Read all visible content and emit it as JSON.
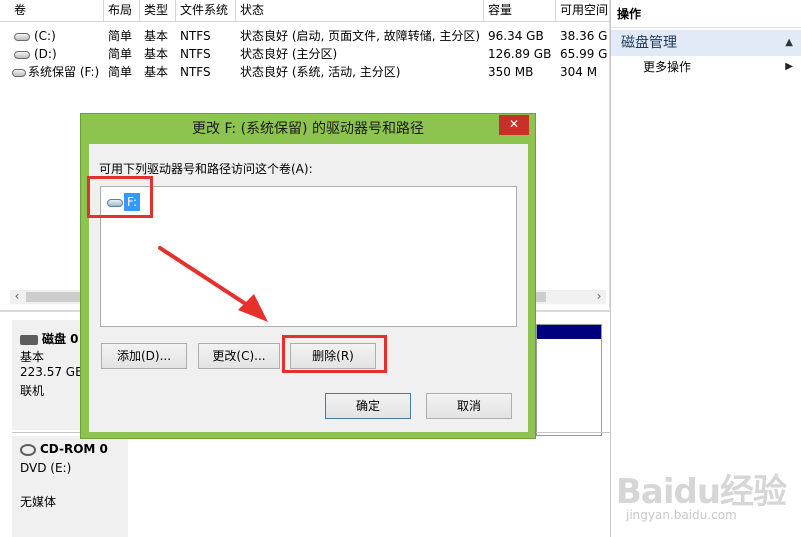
{
  "volume_table": {
    "headers": [
      "卷",
      "布局",
      "类型",
      "文件系统",
      "状态",
      "容量",
      "可用空间"
    ],
    "rows": [
      {
        "name": "(C:)",
        "layout": "简单",
        "type": "基本",
        "fs": "NTFS",
        "status": "状态良好 (启动, 页面文件, 故障转储, 主分区)",
        "capacity": "96.34 GB",
        "free": "38.36 G"
      },
      {
        "name": "(D:)",
        "layout": "简单",
        "type": "基本",
        "fs": "NTFS",
        "status": "状态良好 (主分区)",
        "capacity": "126.89 GB",
        "free": "65.99 G"
      },
      {
        "name": "系统保留 (F:)",
        "layout": "简单",
        "type": "基本",
        "fs": "NTFS",
        "status": "状态良好 (系统, 活动, 主分区)",
        "capacity": "350 MB",
        "free": "304 M"
      }
    ]
  },
  "disks": [
    {
      "name": "磁盘 0",
      "type": "基本",
      "size": "223.57 GB",
      "state": "联机"
    },
    {
      "name": "CD-ROM 0",
      "type": "DVD (E:)",
      "size": "",
      "state": "无媒体"
    }
  ],
  "actions_pane": {
    "title": "操作",
    "section": "磁盘管理",
    "item": "更多操作"
  },
  "dialog": {
    "title": "更改 F: (系统保留) 的驱动器号和路径",
    "close_glyph": "✕",
    "instruction": "可用下列驱动器号和路径访问这个卷(A):",
    "entries": [
      "F:"
    ],
    "add_label": "添加(D)...",
    "change_label": "更改(C)...",
    "remove_label": "删除(R)",
    "ok_label": "确定",
    "cancel_label": "取消"
  },
  "watermark": {
    "brand": "Baidu经验",
    "url": "jingyan.baidu.com"
  },
  "colors": {
    "dialog_frame": "#8cc44f",
    "close_button": "#c7312a",
    "selection": "#3399ff",
    "annotation": "#e5302c",
    "actions_section_bg": "#e1eaf6"
  },
  "icons": [
    "drive-icon",
    "disk-icon",
    "cdrom-icon",
    "close-icon",
    "chevron-up-icon",
    "chevron-right-icon",
    "scroll-left-icon",
    "scroll-right-icon"
  ]
}
